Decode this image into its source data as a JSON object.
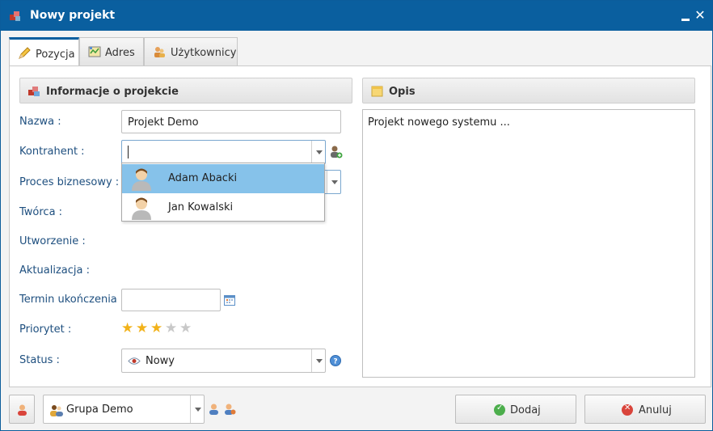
{
  "window": {
    "title": "Nowy projekt",
    "minimize_label": "",
    "close_label": "✕"
  },
  "tabs": [
    {
      "label": "Pozycja",
      "icon": "pencil-icon",
      "active": true
    },
    {
      "label": "Adres",
      "icon": "map-icon",
      "active": false
    },
    {
      "label": "Użytkownicy",
      "icon": "users-icon",
      "active": false
    }
  ],
  "info_section": {
    "title": "Informacje o projekcie",
    "icon": "boxes-icon"
  },
  "desc_section": {
    "title": "Opis",
    "icon": "note-icon",
    "text": "Projekt nowego systemu ..."
  },
  "form": {
    "name_label": "Nazwa :",
    "name_value": "Projekt Demo",
    "contractor_label": "Kontrahent :",
    "contractor_value": "",
    "business_process_label": "Proces biznesowy :",
    "author_label": "Twórca :",
    "created_label": "Utworzenie :",
    "updated_label": "Aktualizacja :",
    "deadline_label": "Termin ukończenia :",
    "deadline_value": "",
    "priority_label": "Priorytet :",
    "priority_value": 3,
    "priority_max": 5,
    "status_label": "Status :",
    "status_value": "Nowy",
    "status_icon": "eye-icon"
  },
  "contractor_dropdown": [
    {
      "label": "Adam Abacki",
      "selected": true
    },
    {
      "label": "Jan Kowalski",
      "selected": false
    }
  ],
  "footer": {
    "group_value": "Grupa Demo",
    "add_button": "Dodaj",
    "cancel_button": "Anuluj"
  },
  "colors": {
    "titlebar": "#0a5f9f",
    "label_text": "#1e4f7f",
    "dropdown_selected": "#86c2ea",
    "star_filled": "#f2b21a",
    "star_empty": "#c8c8c8"
  }
}
